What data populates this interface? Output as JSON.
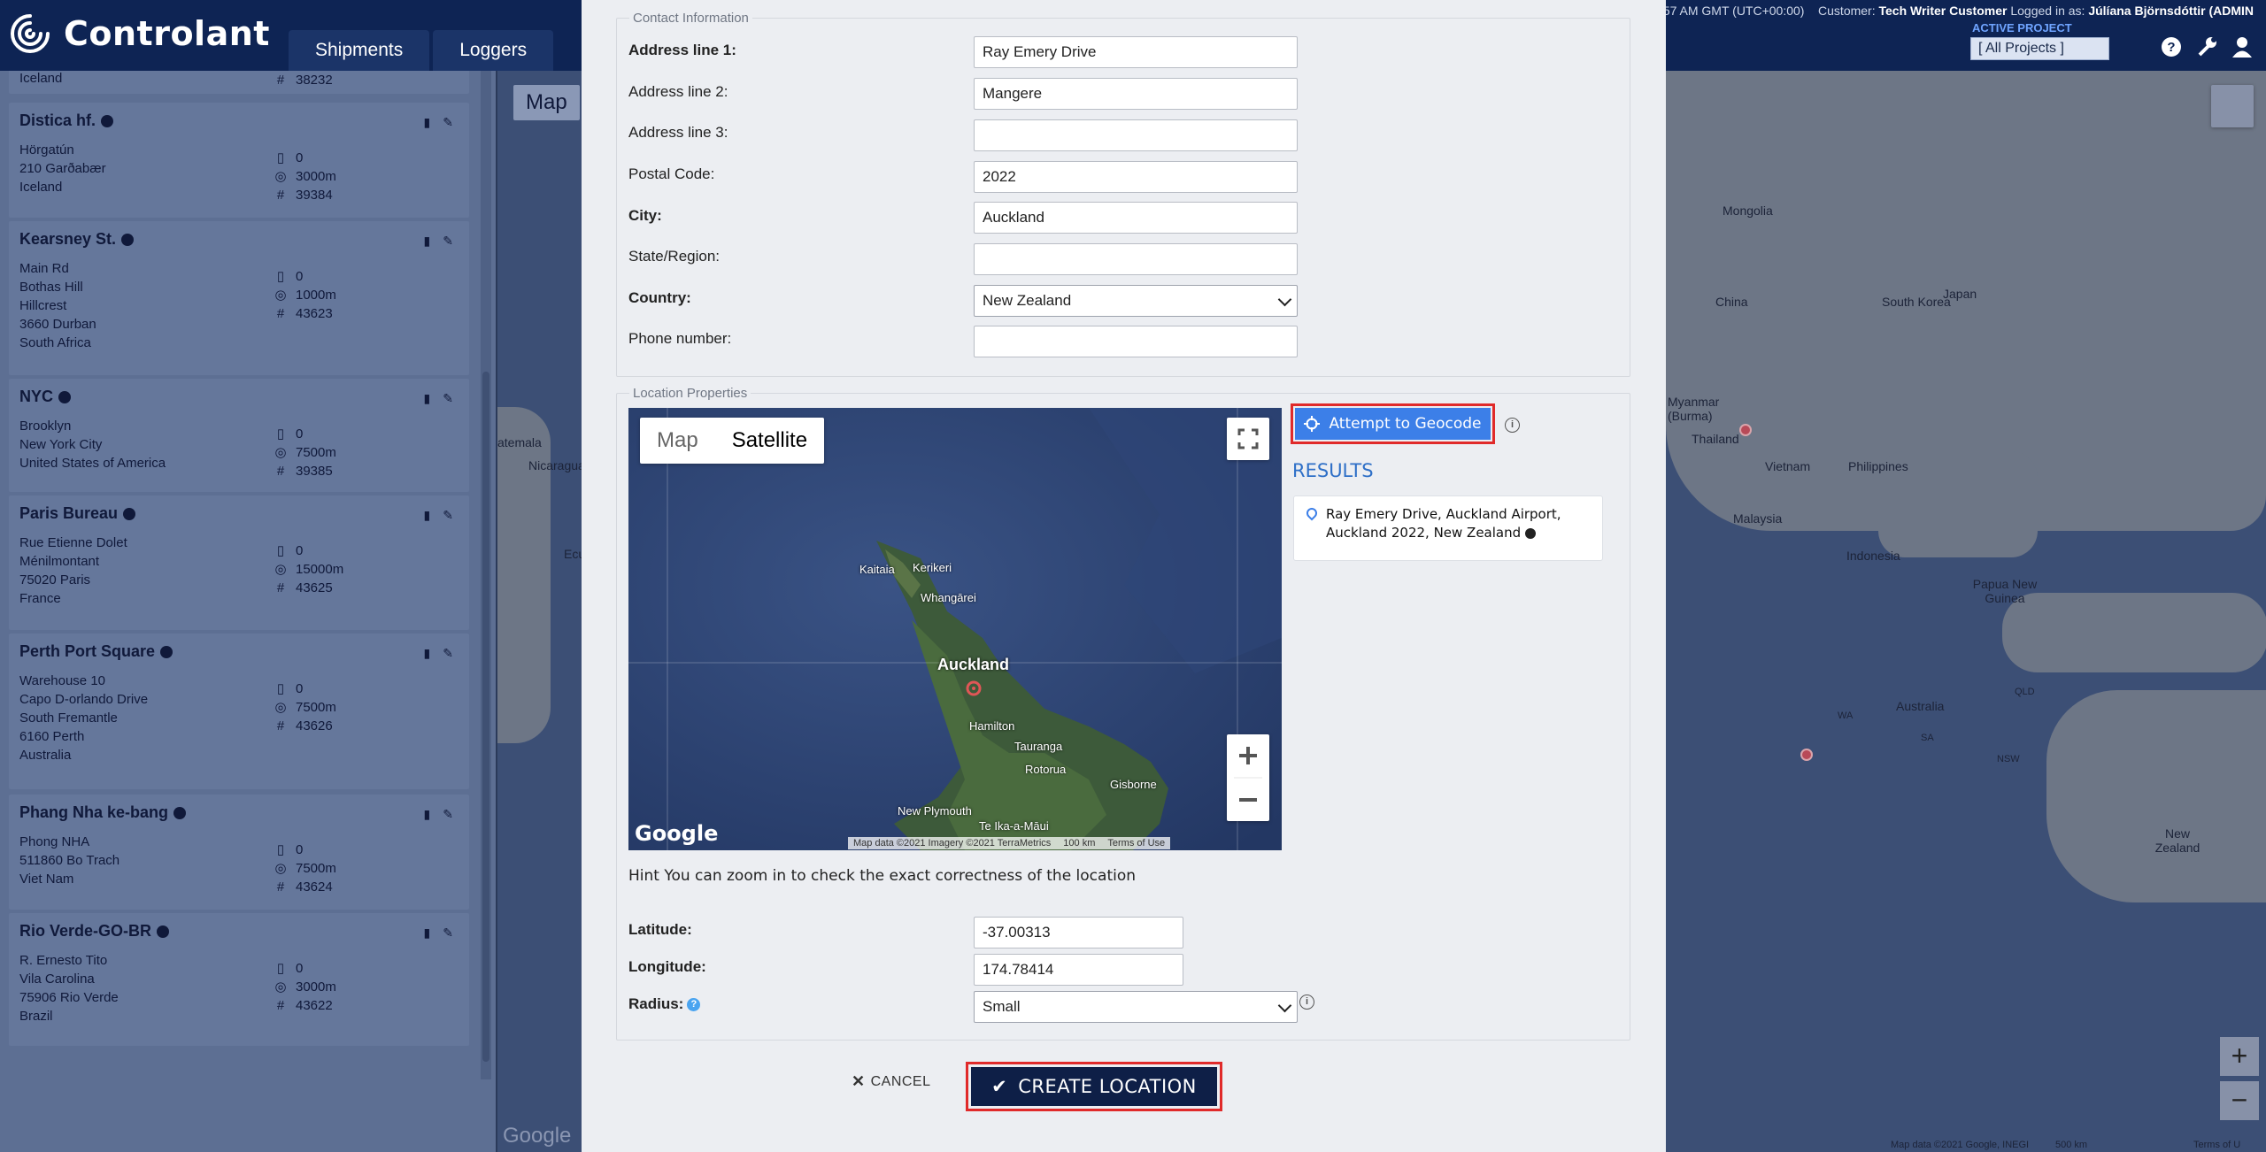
{
  "app": {
    "brand": "Controlant",
    "nav_tabs": [
      "Shipments",
      "Loggers"
    ],
    "header_info_time": ":57 AM GMT (UTC+00:00)",
    "header_customer_label": "Customer:",
    "header_customer": "Tech Writer Customer",
    "header_logged_label": "Logged in as:",
    "header_user": "Júlíana Björnsdóttir (ADMIN",
    "active_project_label": "ACTIVE PROJECT",
    "project_select": "[ All Projects ]",
    "map_button": "Map"
  },
  "sidebar": {
    "first_partial": {
      "line": "Iceland",
      "id": "38232"
    },
    "locations": [
      {
        "name": "Distica hf.",
        "lines": [
          "",
          "Hörgatún",
          "210 Garðabær",
          "Iceland"
        ],
        "count": "0",
        "radius": "3000m",
        "id": "39384"
      },
      {
        "name": "Kearsney St.",
        "lines": [
          "",
          "Main Rd",
          "Bothas Hill",
          "Hillcrest",
          "3660 Durban",
          "South Africa"
        ],
        "count": "0",
        "radius": "1000m",
        "id": "43623"
      },
      {
        "name": "NYC",
        "lines": [
          "",
          "Brooklyn",
          "New York City",
          "United States of America"
        ],
        "count": "0",
        "radius": "7500m",
        "id": "39385"
      },
      {
        "name": "Paris Bureau",
        "lines": [
          "",
          "Rue Etienne Dolet",
          "Ménilmontant",
          "75020 Paris",
          "France"
        ],
        "count": "0",
        "radius": "15000m",
        "id": "43625"
      },
      {
        "name": "Perth Port Square",
        "lines": [
          "",
          "Warehouse 10",
          "Capo D-orlando Drive",
          "South Fremantle",
          "6160 Perth",
          "Australia"
        ],
        "count": "0",
        "radius": "7500m",
        "id": "43626"
      },
      {
        "name": "Phang Nha ke-bang",
        "lines": [
          "",
          "Phong NHA",
          "511860 Bo Trach",
          "Viet Nam"
        ],
        "count": "0",
        "radius": "7500m",
        "id": "43624"
      },
      {
        "name": "Rio Verde-GO-BR",
        "lines": [
          "",
          "R. Ernesto Tito",
          "Vila Carolina",
          "75906 Rio Verde",
          "Brazil"
        ],
        "count": "0",
        "radius": "3000m",
        "id": "43622"
      }
    ]
  },
  "bg_map": {
    "labels": [
      "Mongolia",
      "China",
      "South Korea",
      "Japan",
      "Myanmar (Burma)",
      "Thailand",
      "Vietnam",
      "Philippines",
      "Malaysia",
      "Indonesia",
      "Papua New Guinea",
      "Australia",
      "New Zealand",
      "atemala",
      "Nicaragua",
      "Ecu",
      "WA",
      "QLD",
      "NSW",
      "SA"
    ],
    "attribution": "Map data ©2021 Google, INEGI",
    "scale": "500 km",
    "terms": "Terms of U",
    "google": "Google"
  },
  "form": {
    "contact_legend": "Contact Information",
    "fields": [
      {
        "label": "Address line 1:",
        "value": "Ray Emery Drive",
        "bold": true
      },
      {
        "label": "Address line 2:",
        "value": "Mangere",
        "bold": false
      },
      {
        "label": "Address line 3:",
        "value": "",
        "bold": false
      },
      {
        "label": "Postal Code:",
        "value": "2022",
        "bold": false
      },
      {
        "label": "City:",
        "value": "Auckland",
        "bold": true
      },
      {
        "label": "State/Region:",
        "value": "",
        "bold": false
      }
    ],
    "country_label": "Country:",
    "country_value": "New Zealand",
    "phone_label": "Phone number:",
    "phone_value": "",
    "location_legend": "Location Properties",
    "map_type_map": "Map",
    "map_type_satellite": "Satellite",
    "map_cities": [
      "Kaitaia",
      "Kerikeri",
      "Whangārei",
      "Auckland",
      "Hamilton",
      "Tauranga",
      "Rotorua",
      "Gisborne",
      "New Plymouth",
      "Te Ika-a-Māui"
    ],
    "map_attrib": "Map data ©2021 Imagery ©2021 TerraMetrics",
    "map_scale": "100 km",
    "map_terms": "Terms of Use",
    "google": "Google",
    "geocode_button": "Attempt to Geocode",
    "results_title": "RESULTS",
    "result_text": "Ray Emery Drive, Auckland Airport, Auckland 2022, New Zealand",
    "hint": "Hint You can zoom in to check the exact correctness of the location",
    "latitude_label": "Latitude:",
    "latitude_value": "-37.00313",
    "longitude_label": "Longitude:",
    "longitude_value": "174.78414",
    "radius_label": "Radius:",
    "radius_value": "Small",
    "cancel": "CANCEL",
    "create": "CREATE LOCATION"
  },
  "colors": {
    "accent_blue": "#3c7fe8",
    "primary_dark": "#0e1f47",
    "highlight_red": "#e02a2a"
  }
}
